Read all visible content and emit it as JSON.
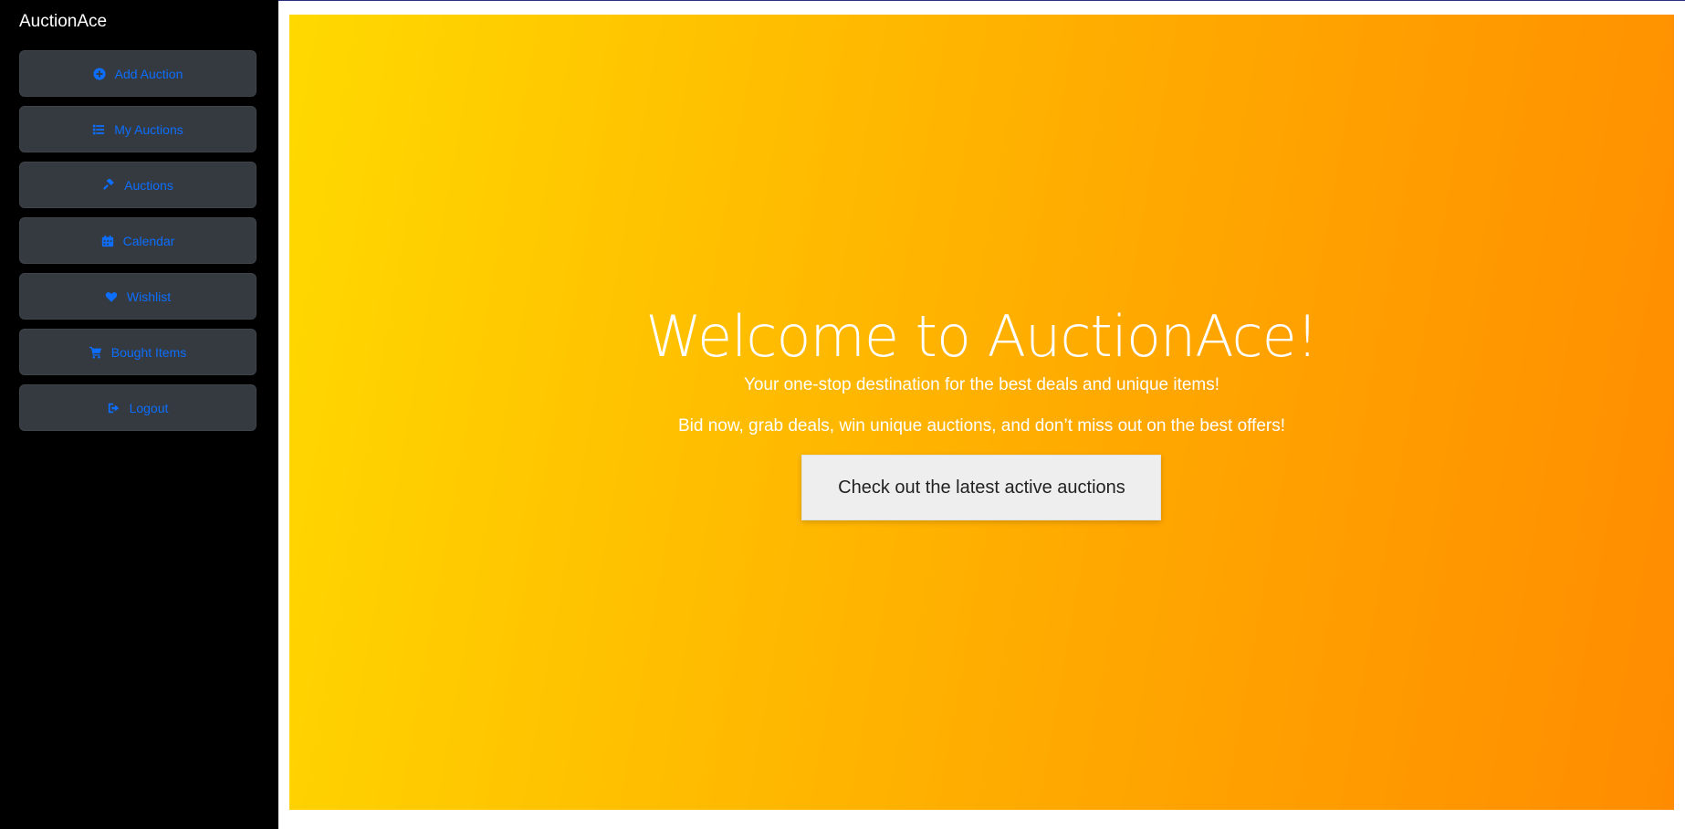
{
  "sidebar": {
    "brand": "AuctionAce",
    "items": [
      {
        "label": "Add Auction",
        "icon": "plus-circle-icon"
      },
      {
        "label": "My Auctions",
        "icon": "list-icon"
      },
      {
        "label": "Auctions",
        "icon": "gavel-icon"
      },
      {
        "label": "Calendar",
        "icon": "calendar-icon"
      },
      {
        "label": "Wishlist",
        "icon": "heart-icon"
      },
      {
        "label": "Bought Items",
        "icon": "cart-icon"
      },
      {
        "label": "Logout",
        "icon": "logout-icon"
      }
    ]
  },
  "hero": {
    "title": "Welcome to AuctionAce!",
    "subtitle": "Your one-stop destination for the best deals and unique items!",
    "tagline": "Bid now, grab deals, win unique auctions, and don’t miss out on the best offers!",
    "cta_label": "Check out the latest active auctions"
  },
  "colors": {
    "sidebar_bg": "#000000",
    "nav_button_bg": "#343a40",
    "nav_text": "#0d6efd",
    "hero_gradient_start": "#ffd900",
    "hero_gradient_end": "#ff8c00",
    "cta_bg": "#eeeeee"
  }
}
